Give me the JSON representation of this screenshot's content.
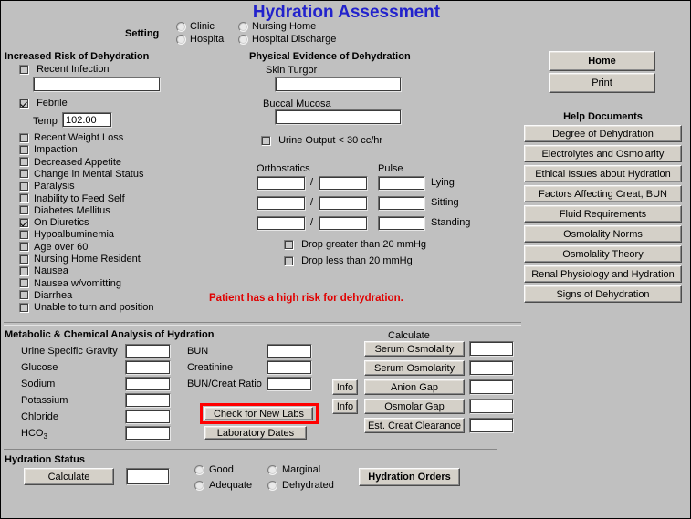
{
  "window": {
    "title": "Hydration Assessment"
  },
  "setting": {
    "label": "Setting",
    "options": [
      {
        "label": "Clinic",
        "selected": false
      },
      {
        "label": "Nursing Home",
        "selected": false
      },
      {
        "label": "Hospital",
        "selected": false
      },
      {
        "label": "Hospital Discharge",
        "selected": false
      }
    ]
  },
  "risk": {
    "heading": "Increased Risk of Dehydration",
    "recent_infection": {
      "label": "Recent Infection",
      "checked": false,
      "value": ""
    },
    "febrile": {
      "label": "Febrile",
      "checked": true
    },
    "temp": {
      "label": "Temp",
      "value": "102.00"
    },
    "items": [
      {
        "label": "Recent Weight Loss",
        "checked": false
      },
      {
        "label": "Impaction",
        "checked": false
      },
      {
        "label": "Decreased Appetite",
        "checked": false
      },
      {
        "label": "Change in Mental Status",
        "checked": false
      },
      {
        "label": "Paralysis",
        "checked": false
      },
      {
        "label": "Inability to Feed Self",
        "checked": false
      },
      {
        "label": "Diabetes Mellitus",
        "checked": false
      },
      {
        "label": "On Diuretics",
        "checked": true
      },
      {
        "label": "Hypoalbuminemia",
        "checked": false
      },
      {
        "label": "Age over 60",
        "checked": false
      },
      {
        "label": "Nursing Home Resident",
        "checked": false
      },
      {
        "label": "Nausea",
        "checked": false
      },
      {
        "label": "Nausea w/vomitting",
        "checked": false
      },
      {
        "label": "Diarrhea",
        "checked": false
      },
      {
        "label": "Unable to turn and position",
        "checked": false
      }
    ]
  },
  "physical": {
    "heading": "Physical Evidence of Dehydration",
    "skin_turgor": {
      "label": "Skin Turgor",
      "value": ""
    },
    "buccal_mucosa": {
      "label": "Buccal Mucosa",
      "value": ""
    },
    "urine_output": {
      "label": "Urine Output < 30 cc/hr",
      "checked": false
    },
    "orthostatics_label": "Orthostatics",
    "pulse_label": "Pulse",
    "rows": [
      {
        "position": "Lying",
        "systolic": "",
        "diastolic": "",
        "pulse": ""
      },
      {
        "position": "Sitting",
        "systolic": "",
        "diastolic": "",
        "pulse": ""
      },
      {
        "position": "Standing",
        "systolic": "",
        "diastolic": "",
        "pulse": ""
      }
    ],
    "drop_greater": {
      "label": "Drop greater than 20 mmHg",
      "checked": false
    },
    "drop_less": {
      "label": "Drop less than 20 mmHg",
      "checked": false
    }
  },
  "alert": {
    "text": "Patient has a high risk for dehydration.",
    "color": "#e00000"
  },
  "nav": {
    "home_label": "Home",
    "print_label": "Print",
    "help_heading": "Help Documents",
    "help_documents": [
      "Degree of Dehydration",
      "Electrolytes and Osmolarity",
      "Ethical Issues about Hydration",
      "Factors Affecting Creat, BUN",
      "Fluid Requirements",
      "Osmolality Norms",
      "Osmolality Theory",
      "Renal Physiology and Hydration",
      "Signs of Dehydration"
    ]
  },
  "labs": {
    "heading": "Metabolic & Chemical Analysis of Hydration",
    "left_fields": [
      {
        "label": "Urine Specific Gravity",
        "value": ""
      },
      {
        "label": "Glucose",
        "value": ""
      },
      {
        "label": "Sodium",
        "value": ""
      },
      {
        "label": "Potassium",
        "value": ""
      },
      {
        "label": "Chloride",
        "value": ""
      },
      {
        "label": "HCO",
        "subscript": "3",
        "value": ""
      }
    ],
    "right_fields": [
      {
        "label": "BUN",
        "value": ""
      },
      {
        "label": "Creatinine",
        "value": ""
      },
      {
        "label": "BUN/Creat Ratio",
        "value": ""
      }
    ],
    "check_new_labs_label": "Check for New Labs",
    "check_new_labs_highlight": "#ff0000",
    "laboratory_dates_label": "Laboratory Dates"
  },
  "calculate": {
    "heading": "Calculate",
    "info_label": "Info",
    "rows": [
      {
        "label": "Serum Osmolality",
        "value": "",
        "has_info": false
      },
      {
        "label": "Serum Osmolarity",
        "value": "",
        "has_info": false
      },
      {
        "label": "Anion Gap",
        "value": "",
        "has_info": true
      },
      {
        "label": "Osmolar Gap",
        "value": "",
        "has_info": true
      },
      {
        "label": "Est. Creat Clearance",
        "value": "",
        "has_info": false
      }
    ]
  },
  "status": {
    "heading": "Hydration Status",
    "calculate_label": "Calculate",
    "result_value": "",
    "options": [
      {
        "label": "Good",
        "selected": false
      },
      {
        "label": "Marginal",
        "selected": false
      },
      {
        "label": "Adequate",
        "selected": false
      },
      {
        "label": "Dehydrated",
        "selected": false
      }
    ],
    "orders_label": "Hydration Orders"
  }
}
